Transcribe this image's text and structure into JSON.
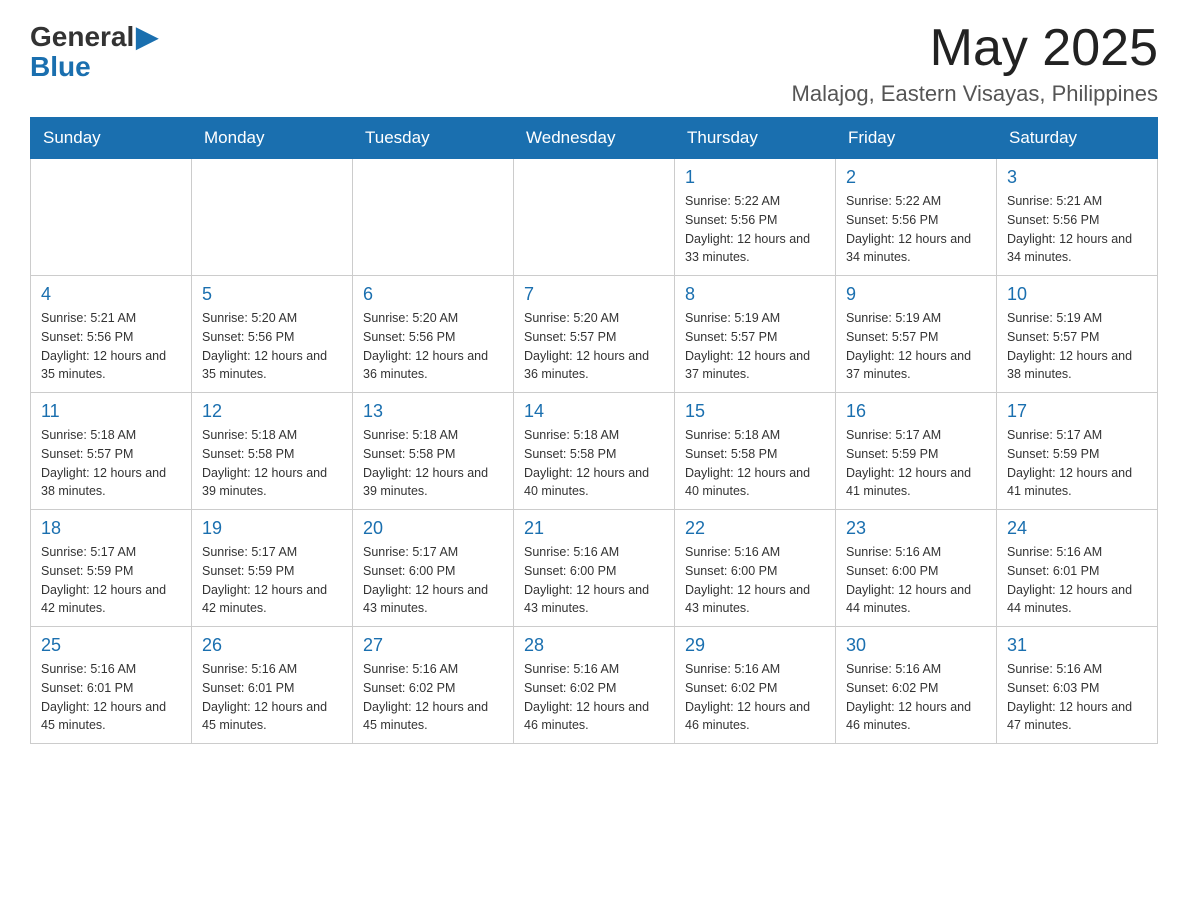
{
  "header": {
    "logo_general": "General",
    "logo_blue": "Blue",
    "month_year": "May 2025",
    "location": "Malajog, Eastern Visayas, Philippines"
  },
  "days_of_week": [
    "Sunday",
    "Monday",
    "Tuesday",
    "Wednesday",
    "Thursday",
    "Friday",
    "Saturday"
  ],
  "weeks": [
    [
      {
        "day": "",
        "info": ""
      },
      {
        "day": "",
        "info": ""
      },
      {
        "day": "",
        "info": ""
      },
      {
        "day": "",
        "info": ""
      },
      {
        "day": "1",
        "info": "Sunrise: 5:22 AM\nSunset: 5:56 PM\nDaylight: 12 hours and 33 minutes."
      },
      {
        "day": "2",
        "info": "Sunrise: 5:22 AM\nSunset: 5:56 PM\nDaylight: 12 hours and 34 minutes."
      },
      {
        "day": "3",
        "info": "Sunrise: 5:21 AM\nSunset: 5:56 PM\nDaylight: 12 hours and 34 minutes."
      }
    ],
    [
      {
        "day": "4",
        "info": "Sunrise: 5:21 AM\nSunset: 5:56 PM\nDaylight: 12 hours and 35 minutes."
      },
      {
        "day": "5",
        "info": "Sunrise: 5:20 AM\nSunset: 5:56 PM\nDaylight: 12 hours and 35 minutes."
      },
      {
        "day": "6",
        "info": "Sunrise: 5:20 AM\nSunset: 5:56 PM\nDaylight: 12 hours and 36 minutes."
      },
      {
        "day": "7",
        "info": "Sunrise: 5:20 AM\nSunset: 5:57 PM\nDaylight: 12 hours and 36 minutes."
      },
      {
        "day": "8",
        "info": "Sunrise: 5:19 AM\nSunset: 5:57 PM\nDaylight: 12 hours and 37 minutes."
      },
      {
        "day": "9",
        "info": "Sunrise: 5:19 AM\nSunset: 5:57 PM\nDaylight: 12 hours and 37 minutes."
      },
      {
        "day": "10",
        "info": "Sunrise: 5:19 AM\nSunset: 5:57 PM\nDaylight: 12 hours and 38 minutes."
      }
    ],
    [
      {
        "day": "11",
        "info": "Sunrise: 5:18 AM\nSunset: 5:57 PM\nDaylight: 12 hours and 38 minutes."
      },
      {
        "day": "12",
        "info": "Sunrise: 5:18 AM\nSunset: 5:58 PM\nDaylight: 12 hours and 39 minutes."
      },
      {
        "day": "13",
        "info": "Sunrise: 5:18 AM\nSunset: 5:58 PM\nDaylight: 12 hours and 39 minutes."
      },
      {
        "day": "14",
        "info": "Sunrise: 5:18 AM\nSunset: 5:58 PM\nDaylight: 12 hours and 40 minutes."
      },
      {
        "day": "15",
        "info": "Sunrise: 5:18 AM\nSunset: 5:58 PM\nDaylight: 12 hours and 40 minutes."
      },
      {
        "day": "16",
        "info": "Sunrise: 5:17 AM\nSunset: 5:59 PM\nDaylight: 12 hours and 41 minutes."
      },
      {
        "day": "17",
        "info": "Sunrise: 5:17 AM\nSunset: 5:59 PM\nDaylight: 12 hours and 41 minutes."
      }
    ],
    [
      {
        "day": "18",
        "info": "Sunrise: 5:17 AM\nSunset: 5:59 PM\nDaylight: 12 hours and 42 minutes."
      },
      {
        "day": "19",
        "info": "Sunrise: 5:17 AM\nSunset: 5:59 PM\nDaylight: 12 hours and 42 minutes."
      },
      {
        "day": "20",
        "info": "Sunrise: 5:17 AM\nSunset: 6:00 PM\nDaylight: 12 hours and 43 minutes."
      },
      {
        "day": "21",
        "info": "Sunrise: 5:16 AM\nSunset: 6:00 PM\nDaylight: 12 hours and 43 minutes."
      },
      {
        "day": "22",
        "info": "Sunrise: 5:16 AM\nSunset: 6:00 PM\nDaylight: 12 hours and 43 minutes."
      },
      {
        "day": "23",
        "info": "Sunrise: 5:16 AM\nSunset: 6:00 PM\nDaylight: 12 hours and 44 minutes."
      },
      {
        "day": "24",
        "info": "Sunrise: 5:16 AM\nSunset: 6:01 PM\nDaylight: 12 hours and 44 minutes."
      }
    ],
    [
      {
        "day": "25",
        "info": "Sunrise: 5:16 AM\nSunset: 6:01 PM\nDaylight: 12 hours and 45 minutes."
      },
      {
        "day": "26",
        "info": "Sunrise: 5:16 AM\nSunset: 6:01 PM\nDaylight: 12 hours and 45 minutes."
      },
      {
        "day": "27",
        "info": "Sunrise: 5:16 AM\nSunset: 6:02 PM\nDaylight: 12 hours and 45 minutes."
      },
      {
        "day": "28",
        "info": "Sunrise: 5:16 AM\nSunset: 6:02 PM\nDaylight: 12 hours and 46 minutes."
      },
      {
        "day": "29",
        "info": "Sunrise: 5:16 AM\nSunset: 6:02 PM\nDaylight: 12 hours and 46 minutes."
      },
      {
        "day": "30",
        "info": "Sunrise: 5:16 AM\nSunset: 6:02 PM\nDaylight: 12 hours and 46 minutes."
      },
      {
        "day": "31",
        "info": "Sunrise: 5:16 AM\nSunset: 6:03 PM\nDaylight: 12 hours and 47 minutes."
      }
    ]
  ]
}
